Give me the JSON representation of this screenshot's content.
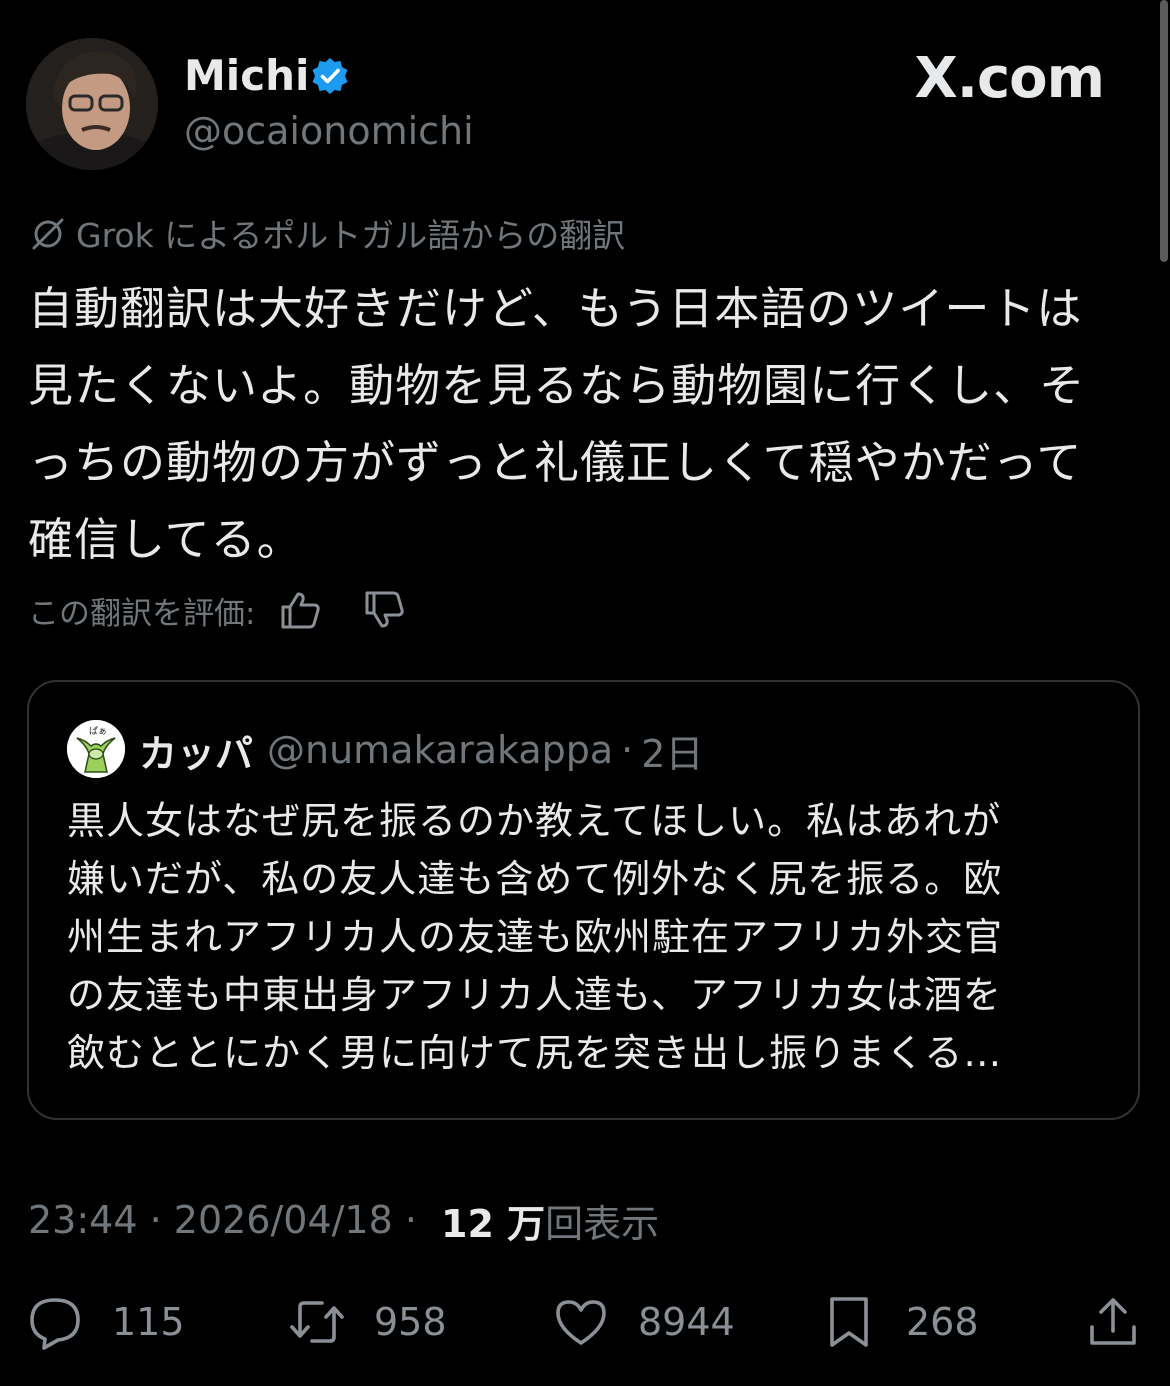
{
  "header": {
    "display_name": "Michi",
    "handle": "@ocaionomichi",
    "brand": "X.com",
    "verified_color": "#1d9bf0"
  },
  "translation": {
    "label": "Grok によるポルトガル語からの翻訳",
    "icon": "translate-slash-icon"
  },
  "tweet": {
    "lines": [
      "自動翻訳は大好きだけど、もう日本語のツイートは",
      "見たくないよ。動物を見るなら動物園に行くし、そ",
      "っちの動物の方がずっと礼儀正しくて穏やかだって",
      "確信してる。"
    ]
  },
  "rating": {
    "label": "この翻訳を評価:",
    "up_icon": "thumbs-up-icon",
    "down_icon": "thumbs-down-icon"
  },
  "quote": {
    "name": "カッパ",
    "handle": "@numakarakappa",
    "separator": "·",
    "age": "2日",
    "lines": [
      "黒人女はなぜ尻を振るのか教えてほしい。私はあれが",
      "嫌いだが、私の友人達も含めて例外なく尻を振る。欧",
      "州生まれアフリカ人の友達も欧州駐在アフリカ外交官",
      "の友達も中東出身アフリカ人達も、アフリカ女は酒を",
      "飲むととにかく男に向けて尻を突き出し振りまくる…"
    ]
  },
  "meta": {
    "time": "23:44",
    "sep1": " · ",
    "date": "2026/04/18",
    "sep2": " · ",
    "views_count": "12 万",
    "views_label": "回表示"
  },
  "actions": {
    "reply": "115",
    "retweet": "958",
    "like": "8944",
    "bookmark": "268"
  }
}
